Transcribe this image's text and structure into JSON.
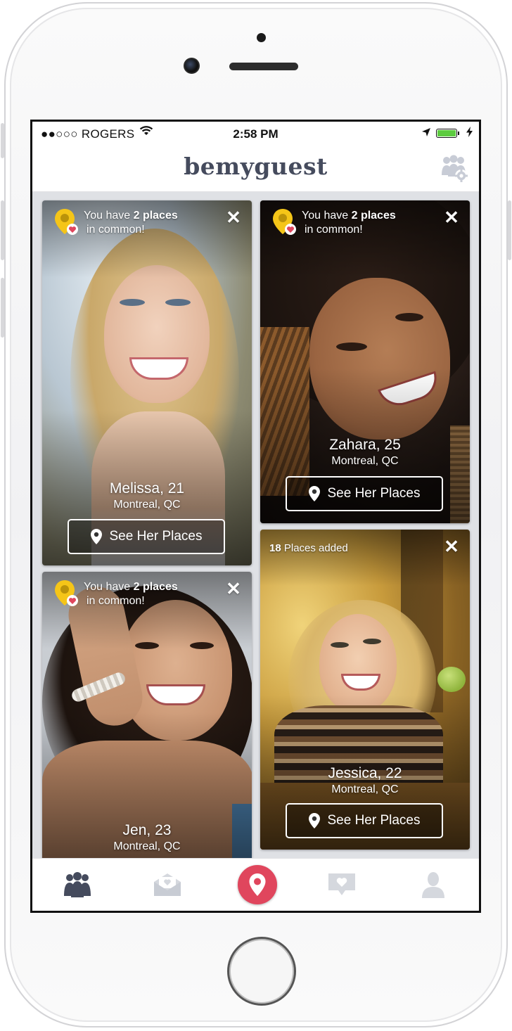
{
  "status_bar": {
    "carrier": "●●○○○ ROGERS",
    "time": "2:58 PM"
  },
  "header": {
    "logo_text": "bemyguest",
    "settings_icon": "group-settings-icon"
  },
  "cards": [
    {
      "id": "melissa",
      "banner_prefix": "You have ",
      "banner_bold": "2 places",
      "banner_line2": "in common!",
      "name": "Melissa, 21",
      "city": "Montreal, QC",
      "button_label": "See Her Places",
      "close_label": "✕"
    },
    {
      "id": "zahara",
      "banner_prefix": "You have ",
      "banner_bold": "2 places",
      "banner_line2": "in common!",
      "name": "Zahara, 25",
      "city": "Montreal, QC",
      "button_label": "See Her Places",
      "close_label": "✕"
    },
    {
      "id": "jen",
      "banner_prefix": "You have ",
      "banner_bold": "2 places",
      "banner_line2": "in common!",
      "name": "Jen, 23",
      "city": "Montreal, QC",
      "close_label": "✕"
    },
    {
      "id": "jessica",
      "places_count": "18",
      "places_label": " Places added",
      "name": "Jessica, 22",
      "city": "Montreal, QC",
      "button_label": "See Her Places",
      "close_label": "✕"
    }
  ],
  "tab_bar": {
    "tabs": [
      {
        "icon": "people-icon",
        "active": true
      },
      {
        "icon": "envelope-heart-icon",
        "active": false
      },
      {
        "icon": "location-pin-icon",
        "active": true,
        "center": true
      },
      {
        "icon": "chat-heart-icon",
        "active": false
      },
      {
        "icon": "profile-icon",
        "active": false
      }
    ]
  },
  "colors": {
    "accent": "#e0465d",
    "badge_yellow": "#f5c518",
    "logo": "#454b5d",
    "battery": "#5ccb3f"
  }
}
